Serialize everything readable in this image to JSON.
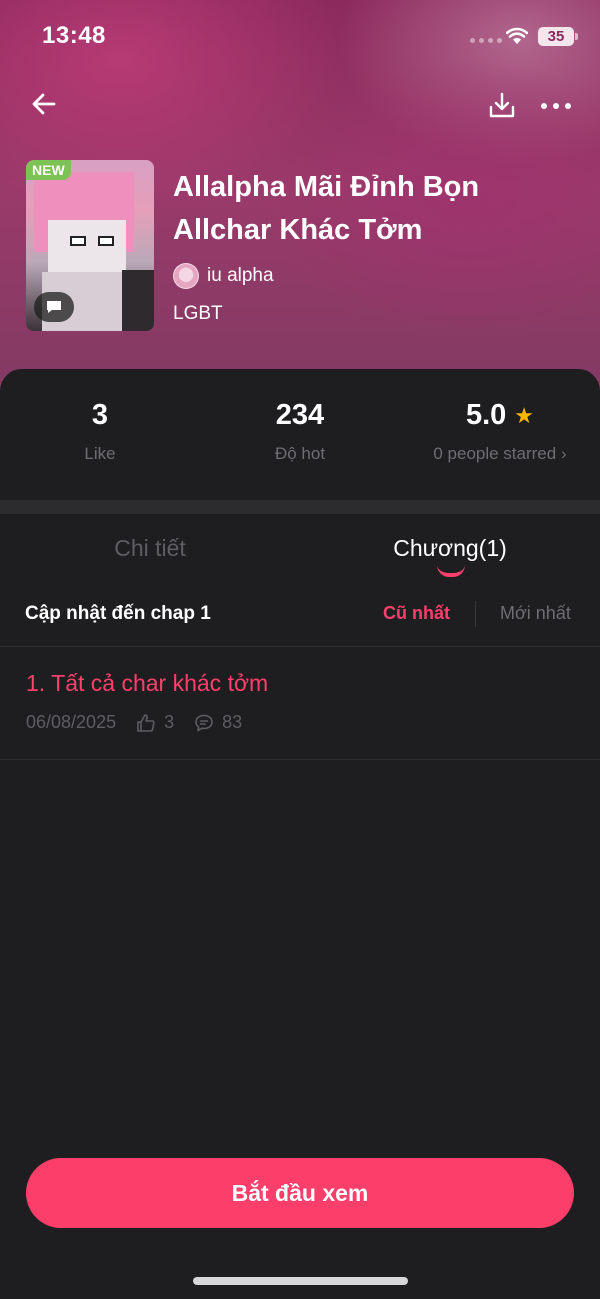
{
  "status_bar": {
    "time": "13:48",
    "battery": "35"
  },
  "cover": {
    "badge": "NEW"
  },
  "book": {
    "title": "Allalpha Mãi Đỉnh Bọn Allchar Khác Tởm",
    "author": "iu alpha",
    "genre": "LGBT"
  },
  "stats": {
    "like": {
      "value": "3",
      "label": "Like"
    },
    "hot": {
      "value": "234",
      "label": "Độ hot"
    },
    "rating": {
      "value": "5.0",
      "label": "0 people starred"
    }
  },
  "tabs": [
    {
      "label": "Chi tiết",
      "active": false
    },
    {
      "label": "Chương(1)",
      "active": true
    }
  ],
  "chapter_list": {
    "update_text": "Cập nhật đến chap 1",
    "sort_oldest": "Cũ nhất",
    "sort_newest": "Mới nhất",
    "items": [
      {
        "title": "1. Tất cả char khác tởm",
        "date": "06/08/2025",
        "likes": "3",
        "comments": "83"
      }
    ]
  },
  "start_button": "Bắt đầu xem",
  "colors": {
    "accent": "#fc3f6a",
    "badge_new": "#7dc254",
    "star": "#f5b400",
    "background": "#1e1e20"
  }
}
